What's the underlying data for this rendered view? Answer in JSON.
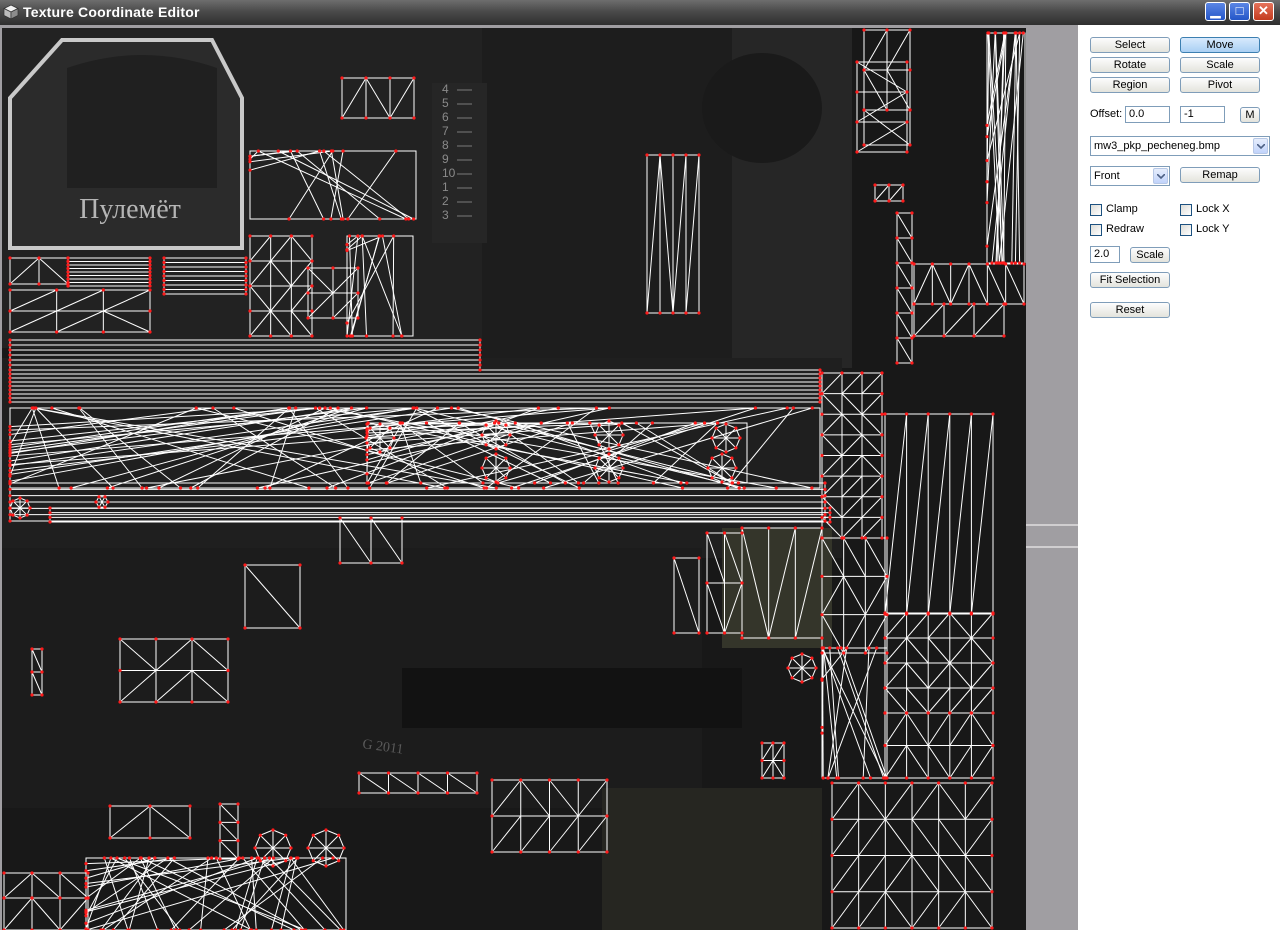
{
  "window": {
    "title": "Texture Coordinate Editor",
    "controls": {
      "minimize": "▁",
      "maximize": "□",
      "close": "✕"
    }
  },
  "viewport": {
    "texture_label": "Пулемёт",
    "stamp_text": "G 2011",
    "ruler_digits": [
      "4",
      "5",
      "6",
      "7",
      "8",
      "9",
      "10",
      "1",
      "2",
      "3"
    ]
  },
  "panel": {
    "buttons": {
      "select": "Select",
      "move": "Move",
      "rotate": "Rotate",
      "scale": "Scale",
      "region": "Region",
      "pivot": "Pivot",
      "m": "M",
      "remap": "Remap",
      "scale_apply": "Scale",
      "fit_selection": "Fit Selection",
      "reset": "Reset"
    },
    "offset_label": "Offset:",
    "offset_x": "0.0",
    "offset_y": "-1",
    "texture_file": "mw3_pkp_pecheneg.bmp",
    "view_option": "Front",
    "checkboxes": {
      "clamp": "Clamp",
      "lock_x": "Lock X",
      "redraw": "Redraw",
      "lock_y": "Lock Y"
    },
    "scale_value": "2.0"
  },
  "colors": {
    "wire": "#ffffff",
    "vertex": "#ff1a1a",
    "active_button": "#a9cff3"
  }
}
